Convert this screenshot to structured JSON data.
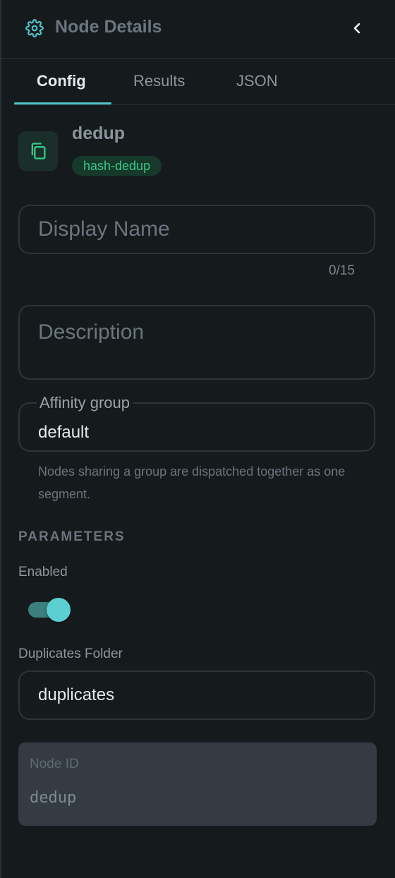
{
  "header": {
    "title": "Node Details",
    "icon": "gear-icon",
    "back_icon": "chevron-left-icon"
  },
  "tabs": [
    {
      "label": "Config",
      "active": true
    },
    {
      "label": "Results",
      "active": false
    },
    {
      "label": "JSON",
      "active": false
    }
  ],
  "node": {
    "name": "dedup",
    "type_badge": "hash-dedup",
    "icon": "copy-icon"
  },
  "fields": {
    "display_name": {
      "placeholder": "Display Name",
      "value": "",
      "counter": "0/15"
    },
    "description": {
      "placeholder": "Description",
      "value": ""
    },
    "affinity_group": {
      "label": "Affinity group",
      "value": "default",
      "helper": "Nodes sharing a group are dispatched together as one segment."
    }
  },
  "parameters": {
    "section_title": "PARAMETERS",
    "enabled": {
      "label": "Enabled",
      "value": true
    },
    "duplicates_folder": {
      "label": "Duplicates Folder",
      "value": "duplicates"
    }
  },
  "node_id": {
    "label": "Node ID",
    "value": "dedup"
  },
  "colors": {
    "accent": "#4fc2c6",
    "badge_text": "#39c888",
    "badge_bg": "#16392b",
    "background": "#151a1d"
  }
}
